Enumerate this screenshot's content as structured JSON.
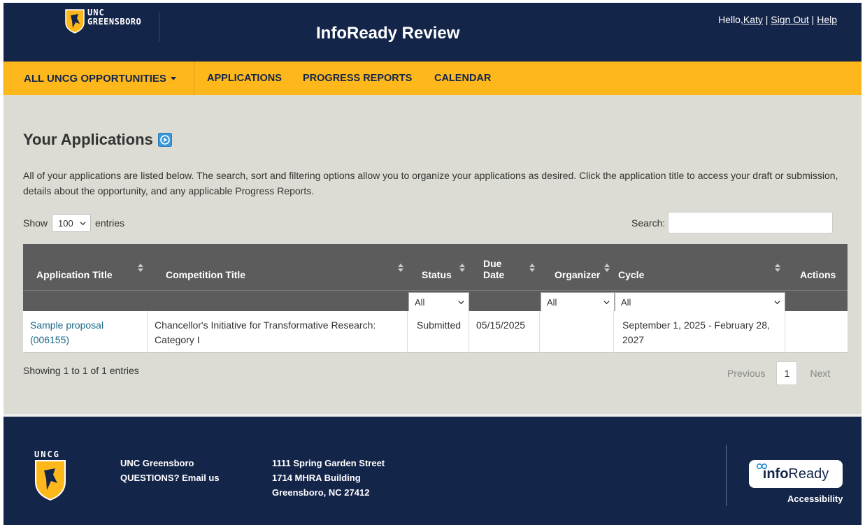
{
  "header": {
    "logo_line1": "UNC",
    "logo_line2": "GREENSBORO",
    "site_title": "InfoReady Review",
    "greeting": "Hello,",
    "user_name": "Katy",
    "sep1": " | ",
    "sign_out": "Sign Out",
    "sep2": " | ",
    "help": "Help"
  },
  "nav": {
    "opportunities": "ALL UNCG OPPORTUNITIES",
    "applications": "APPLICATIONS",
    "progress_reports": "PROGRESS REPORTS",
    "calendar": "CALENDAR"
  },
  "main": {
    "title": "Your Applications",
    "intro": "All of your applications are listed below. The search, sort and filtering options allow you to organize your applications as desired. Click the application title to access your draft or submission, details about the opportunity, and any applicable Progress Reports.",
    "show_label": "Show",
    "show_value": "100",
    "entries_label": "entries",
    "search_label": "Search:",
    "search_value": ""
  },
  "table": {
    "columns": {
      "application_title": "Application Title",
      "competition_title": "Competition Title",
      "status": "Status",
      "due_date_1": "Due",
      "due_date_2": "Date",
      "organizer": "Organizer",
      "cycle": "Cycle",
      "actions": "Actions"
    },
    "filters": {
      "status": "All",
      "organizer": "All",
      "cycle": "All"
    },
    "rows": [
      {
        "application_title": "Sample proposal (006155)",
        "competition_title": "Chancellor's Initiative for Transformative Research: Category I",
        "status": "Submitted",
        "due_date": "05/15/2025",
        "organizer": "",
        "cycle": "September 1, 2025 - February 28, 2027",
        "actions": ""
      }
    ],
    "info": "Showing 1 to 1 of 1 entries",
    "pager": {
      "previous": "Previous",
      "page": "1",
      "next": "Next"
    }
  },
  "footer": {
    "logo_text": "UNCG",
    "org": "UNC Greensboro",
    "questions": "QUESTIONS? Email us",
    "address1": "1111 Spring Garden Street",
    "address2": "1714 MHRA Building",
    "address3": "Greensboro, NC 27412",
    "badge_bold": "info",
    "badge_rest": "Ready",
    "accessibility": "Accessibility"
  },
  "colors": {
    "navy": "#14254a",
    "gold": "#ffb81c",
    "table_header": "#5c5c5c",
    "link": "#1a6a88",
    "page_bg": "#dcdcd4"
  }
}
